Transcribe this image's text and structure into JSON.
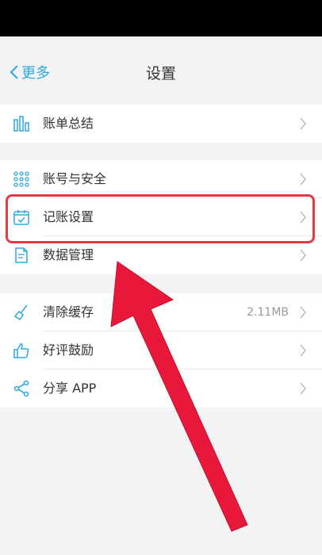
{
  "nav": {
    "back_label": "更多",
    "title": "设置"
  },
  "groups": [
    [
      {
        "label": "账单总结",
        "icon": "bar-chart-icon"
      }
    ],
    [
      {
        "label": "账号与安全",
        "icon": "grid-dots-icon"
      },
      {
        "label": "记账设置",
        "icon": "calendar-check-icon"
      },
      {
        "label": "数据管理",
        "icon": "data-file-icon"
      }
    ],
    [
      {
        "label": "清除缓存",
        "value": "2.11MB",
        "icon": "broom-icon"
      },
      {
        "label": "好评鼓励",
        "icon": "thumbs-up-icon"
      },
      {
        "label": "分享 APP",
        "icon": "share-icon"
      }
    ]
  ],
  "colors": {
    "accent": "#2aa9df",
    "highlight": "#e63946",
    "background": "#f3f3f5"
  }
}
